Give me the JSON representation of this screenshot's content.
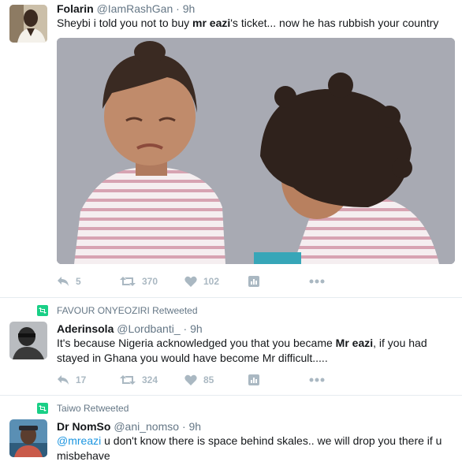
{
  "tweets": [
    {
      "fullname": "Folarin",
      "handle": "@IamRashGan",
      "dot": "·",
      "time": "9h",
      "text_pre": "Sheybi  i told you not to buy ",
      "text_bold": "mr eazi",
      "text_post": "'s ticket... now he has rubbish your country",
      "counts": {
        "reply": "5",
        "retweet": "370",
        "like": "102"
      }
    },
    {
      "context": "FAVOUR ONYEOZIRI Retweeted",
      "fullname": "Aderinsola",
      "handle": "@Lordbanti_",
      "dot": "·",
      "time": "9h",
      "text_pre": "It's because Nigeria acknowledged you that you became ",
      "text_bold": "Mr eazi",
      "text_post": ", if you had stayed in Ghana you would have become Mr difficult.....",
      "counts": {
        "reply": "17",
        "retweet": "324",
        "like": "85"
      }
    },
    {
      "context": "Taiwo Retweeted",
      "fullname": "Dr NomSo",
      "handle": "@ani_nomso",
      "dot": "·",
      "time": "9h",
      "mention": "@mreazi",
      "text_post": " u don't know there is space behind skales.. we will drop you there if u misbehave"
    }
  ],
  "icons": [
    "reply-icon",
    "retweet-icon",
    "like-icon",
    "analytics-icon",
    "more-icon",
    "retweet-badge-icon"
  ],
  "colors": {
    "action_grey": "#aab8c2",
    "meta_grey": "#657786",
    "retweet_green": "#19cf86",
    "link_blue": "#1b95e0"
  }
}
